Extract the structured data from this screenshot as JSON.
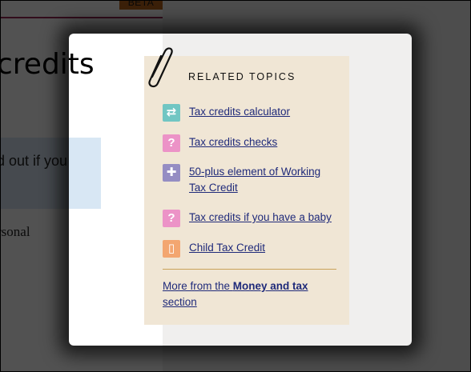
{
  "background_page": {
    "beta_badge": "BETA",
    "heading_fragment": "credits",
    "info_box_text": "d out if you",
    "body_fragment": "rsonal"
  },
  "related_topics": {
    "title": "RELATED TOPICS",
    "items": [
      {
        "label": "Tax credits calculator",
        "icon": "arrows-exchange-icon",
        "icon_glyph": "⇄",
        "icon_color": "#71c6c3"
      },
      {
        "label": "Tax credits checks",
        "icon": "question-icon",
        "icon_glyph": "?",
        "icon_color": "#ec93c7"
      },
      {
        "label": "50-plus element of Working Tax Credit",
        "icon": "plus-icon",
        "icon_glyph": "✚",
        "icon_color": "#958dc3"
      },
      {
        "label": "Tax credits if you have a baby",
        "icon": "question-icon",
        "icon_glyph": "?",
        "icon_color": "#ec93c7"
      },
      {
        "label": "Child Tax Credit",
        "icon": "document-icon",
        "icon_glyph": "▯",
        "icon_color": "#f3a670"
      }
    ],
    "more_link": {
      "prefix": "More from the ",
      "section_name": "Money and tax",
      "suffix": " section"
    }
  },
  "colors": {
    "panel_background": "#f0e6d5",
    "link_color": "#1f2a7a",
    "divider_color": "#c9a25a",
    "overlay": "rgba(0,0,0,0.68)"
  }
}
